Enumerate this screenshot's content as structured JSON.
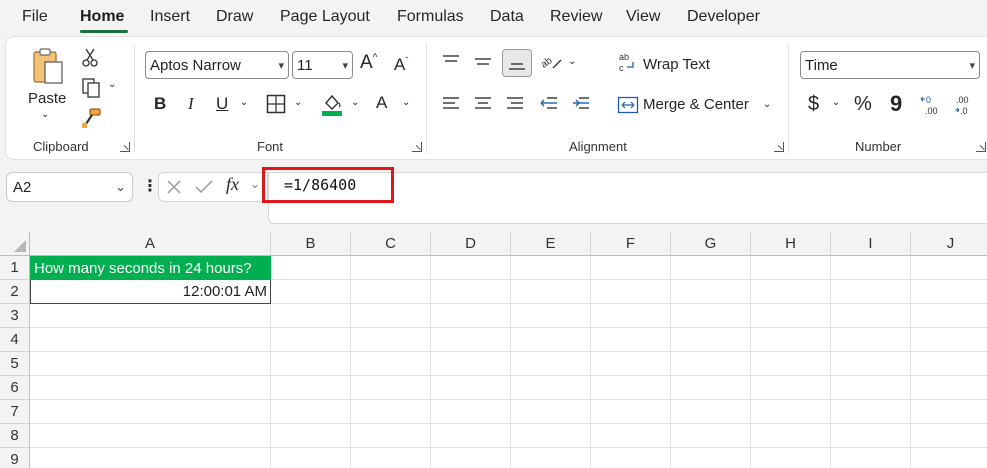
{
  "menu": {
    "tabs": [
      "File",
      "Home",
      "Insert",
      "Draw",
      "Page Layout",
      "Formulas",
      "Data",
      "Review",
      "View",
      "Developer"
    ],
    "active": "Home"
  },
  "ribbon": {
    "clipboard": {
      "paste_label": "Paste",
      "group_label": "Clipboard"
    },
    "font": {
      "font_name": "Aptos Narrow",
      "font_size": "11",
      "bold": "B",
      "italic": "I",
      "underline": "U",
      "font_color_glyph": "A",
      "group_label": "Font",
      "font_color": "#00b050"
    },
    "alignment": {
      "wrap_text": "Wrap Text",
      "merge_center": "Merge & Center",
      "group_label": "Alignment"
    },
    "number": {
      "format": "Time",
      "currency": "$",
      "percent": "%",
      "comma": "9",
      "group_label": "Number"
    }
  },
  "formula_bar": {
    "name_box": "A2",
    "fx": "fx",
    "formula": "=1/86400"
  },
  "sheet": {
    "columns": [
      "A",
      "B",
      "C",
      "D",
      "E",
      "F",
      "G",
      "H",
      "I",
      "J"
    ],
    "rows": [
      "1",
      "2",
      "3",
      "4",
      "5",
      "6",
      "7",
      "8",
      "9"
    ],
    "cells": {
      "A1": "How many seconds in 24 hours?",
      "A2": "12:00:01 AM"
    },
    "a1_fill": "#00b050",
    "highlight_color": "#e0161b"
  }
}
